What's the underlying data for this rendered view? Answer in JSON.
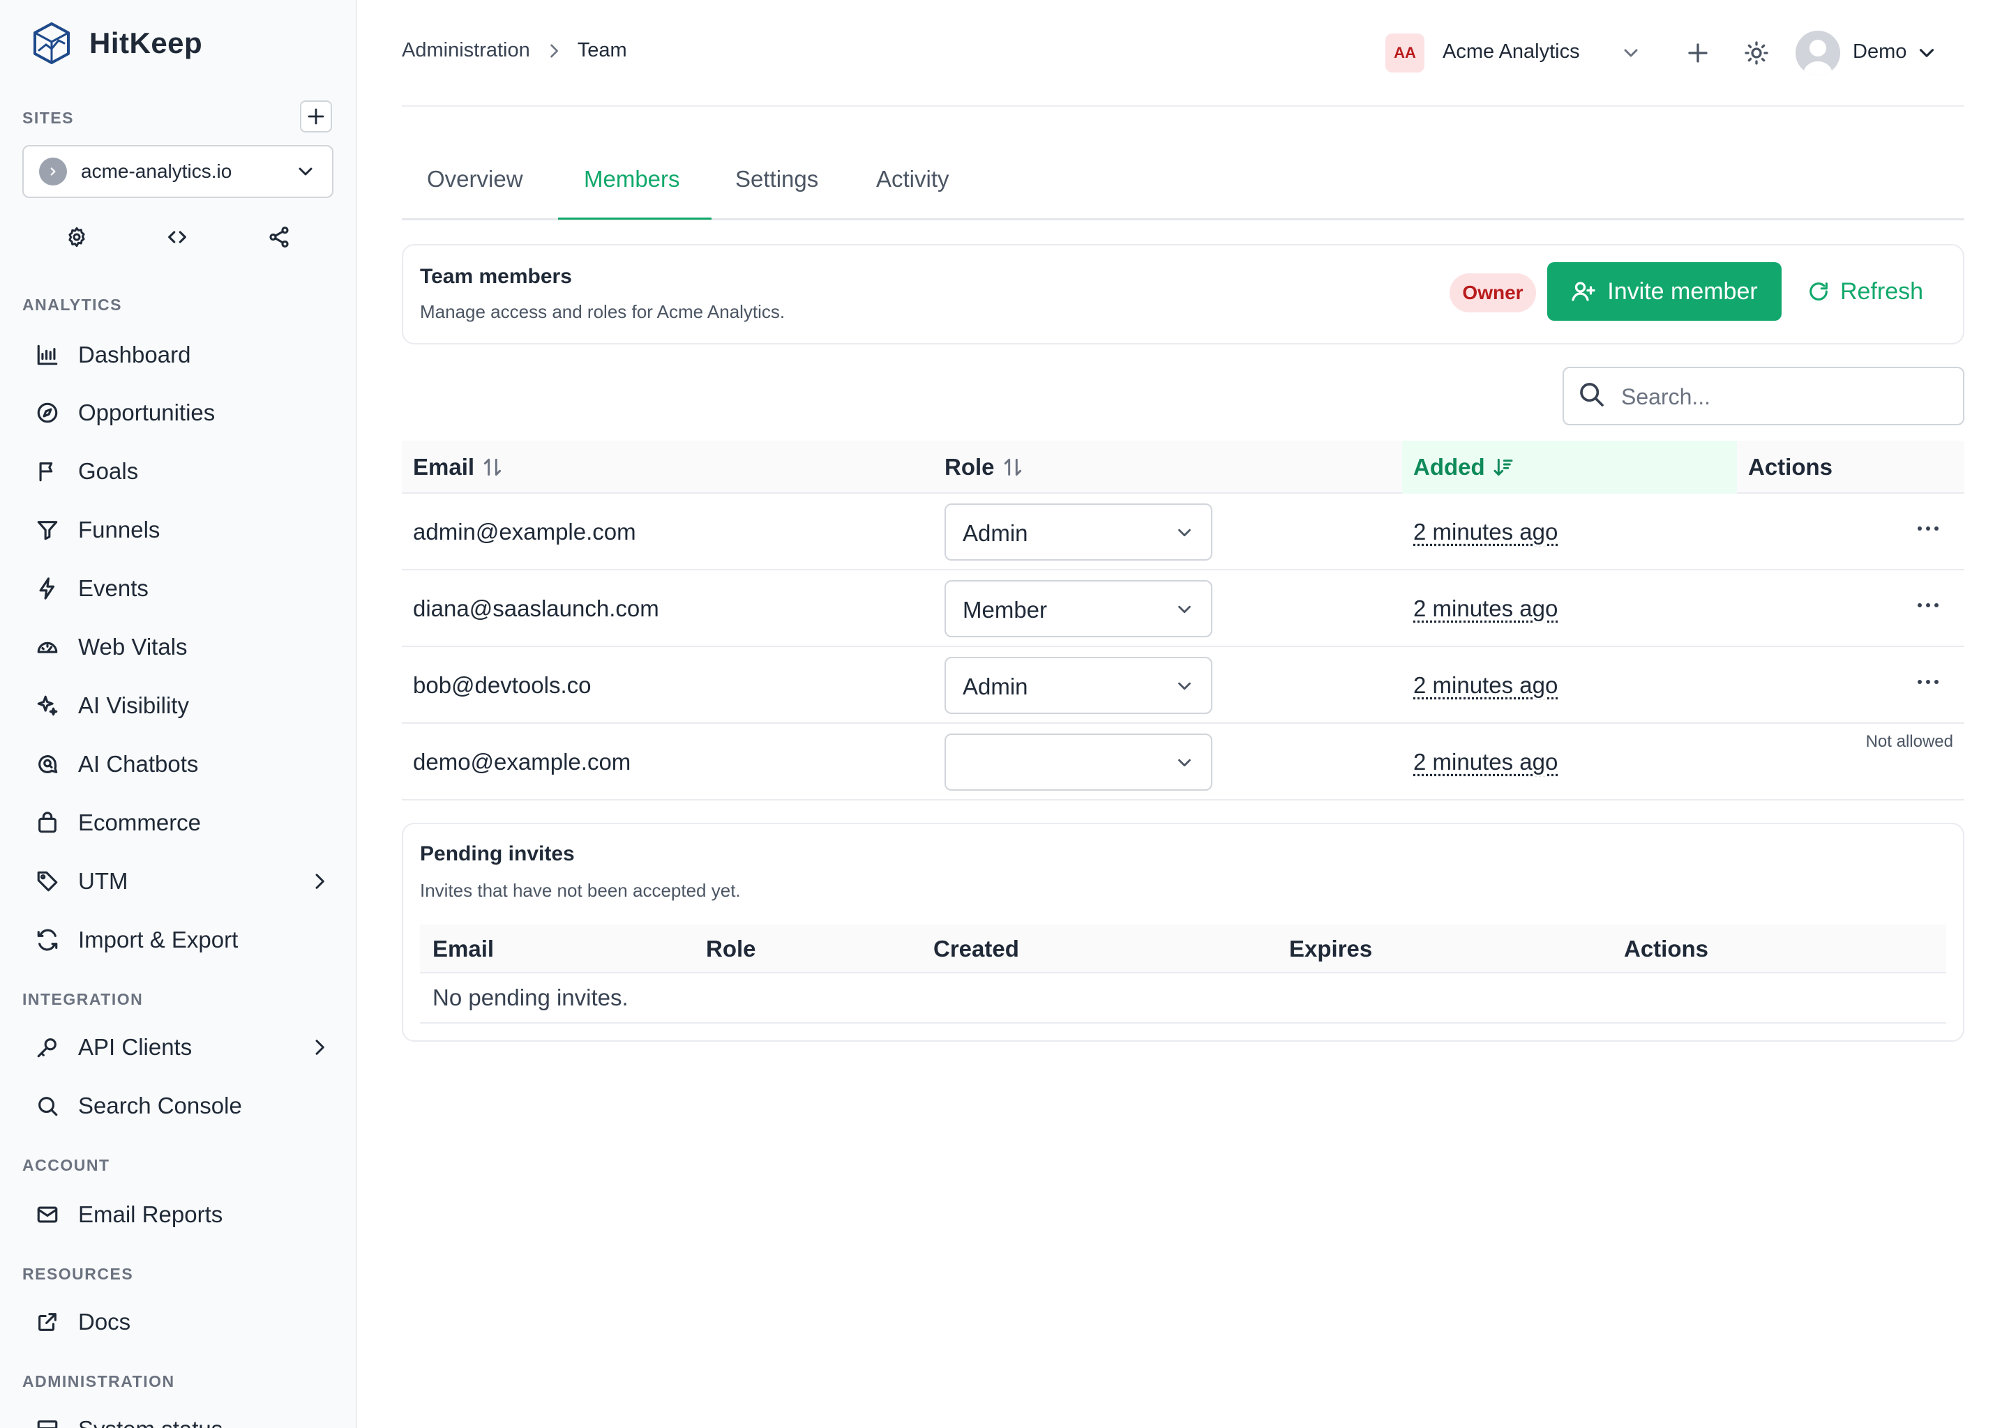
{
  "app": {
    "name": "HitKeep"
  },
  "sidebar": {
    "sites_label": "SITES",
    "site": {
      "name": "acme-analytics.io"
    },
    "sections": {
      "analytics": "ANALYTICS",
      "integration": "INTEGRATION",
      "account": "ACCOUNT",
      "resources": "RESOURCES",
      "administration": "ADMINISTRATION"
    },
    "items": [
      {
        "label": "Dashboard",
        "icon": "bar-chart-icon"
      },
      {
        "label": "Opportunities",
        "icon": "compass-icon"
      },
      {
        "label": "Goals",
        "icon": "flag-icon"
      },
      {
        "label": "Funnels",
        "icon": "filter-icon"
      },
      {
        "label": "Events",
        "icon": "bolt-icon"
      },
      {
        "label": "Web Vitals",
        "icon": "gauge-icon"
      },
      {
        "label": "AI Visibility",
        "icon": "sparkle-icon"
      },
      {
        "label": "AI Chatbots",
        "icon": "chat-search-icon"
      },
      {
        "label": "Ecommerce",
        "icon": "shopping-bag-icon"
      },
      {
        "label": "UTM",
        "icon": "tag-icon"
      },
      {
        "label": "Import & Export",
        "icon": "sync-icon"
      },
      {
        "label": "API Clients",
        "icon": "key-icon"
      },
      {
        "label": "Search Console",
        "icon": "search-icon"
      },
      {
        "label": "Email Reports",
        "icon": "mail-icon"
      },
      {
        "label": "Docs",
        "icon": "external-link-icon"
      },
      {
        "label": "System status",
        "icon": "server-icon"
      }
    ]
  },
  "header": {
    "breadcrumb": [
      "Administration",
      "Team"
    ],
    "org": {
      "initials": "AA",
      "name": "Acme Analytics"
    },
    "user": {
      "name": "Demo"
    }
  },
  "tabs": [
    {
      "label": "Overview",
      "active": false
    },
    {
      "label": "Members",
      "active": true
    },
    {
      "label": "Settings",
      "active": false
    },
    {
      "label": "Activity",
      "active": false
    }
  ],
  "team": {
    "title": "Team members",
    "subtitle": "Manage access and roles for Acme Analytics.",
    "role_badge": "Owner",
    "invite_label": "Invite member",
    "refresh_label": "Refresh",
    "search_placeholder": "Search..."
  },
  "members_table": {
    "columns": [
      "Email",
      "Role",
      "Added",
      "Actions"
    ],
    "sorted_column": "Added",
    "rows": [
      {
        "email": "admin@example.com",
        "role": "Admin",
        "added": "2 minutes ago",
        "action": "menu"
      },
      {
        "email": "diana@saaslaunch.com",
        "role": "Member",
        "added": "2 minutes ago",
        "action": "menu"
      },
      {
        "email": "bob@devtools.co",
        "role": "Admin",
        "added": "2 minutes ago",
        "action": "menu"
      },
      {
        "email": "demo@example.com",
        "role": "",
        "added": "2 minutes ago",
        "action": "Not allowed"
      }
    ]
  },
  "pending": {
    "title": "Pending invites",
    "subtitle": "Invites that have not been accepted yet.",
    "columns": [
      "Email",
      "Role",
      "Created",
      "Expires",
      "Actions"
    ],
    "empty": "No pending invites."
  },
  "colors": {
    "accent": "#10a86b",
    "owner_badge_bg": "#fde2e4",
    "owner_badge_text": "#b91c1c"
  }
}
